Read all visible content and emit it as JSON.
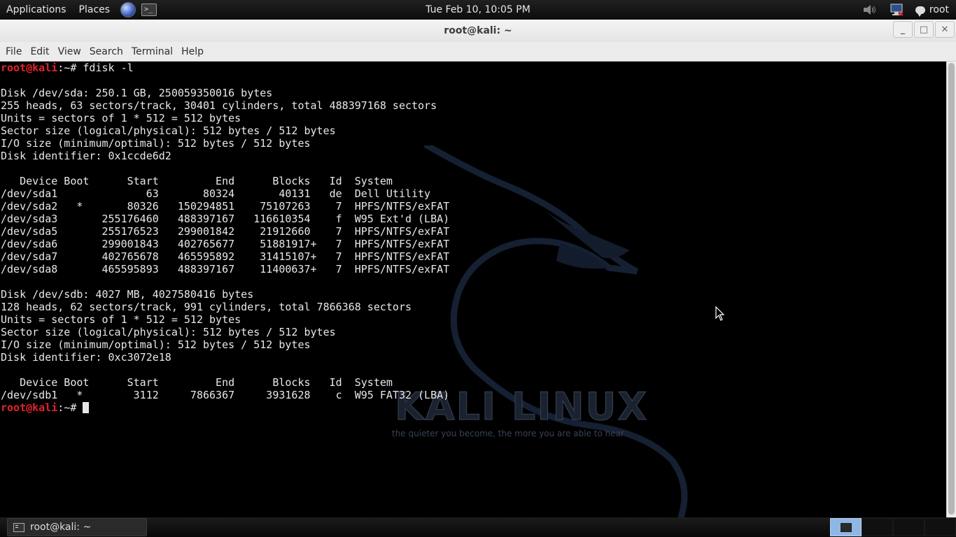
{
  "top_panel": {
    "applications": "Applications",
    "places": "Places",
    "clock": "Tue Feb 10, 10:05 PM",
    "user": "root"
  },
  "window": {
    "title": "root@kali: ~",
    "menu": [
      "File",
      "Edit",
      "View",
      "Search",
      "Terminal",
      "Help"
    ],
    "controls": {
      "minimize": "_",
      "maximize": "□",
      "close": "✕"
    }
  },
  "terminal": {
    "prompt_user": "root@kali",
    "prompt_path": ":~#",
    "command": " fdisk -l",
    "output": [
      "",
      "Disk /dev/sda: 250.1 GB, 250059350016 bytes",
      "255 heads, 63 sectors/track, 30401 cylinders, total 488397168 sectors",
      "Units = sectors of 1 * 512 = 512 bytes",
      "Sector size (logical/physical): 512 bytes / 512 bytes",
      "I/O size (minimum/optimal): 512 bytes / 512 bytes",
      "Disk identifier: 0x1ccde6d2",
      "",
      "   Device Boot      Start         End      Blocks   Id  System",
      "/dev/sda1              63       80324       40131   de  Dell Utility",
      "/dev/sda2   *       80326   150294851    75107263    7  HPFS/NTFS/exFAT",
      "/dev/sda3       255176460   488397167   116610354    f  W95 Ext'd (LBA)",
      "/dev/sda5       255176523   299001842    21912660    7  HPFS/NTFS/exFAT",
      "/dev/sda6       299001843   402765677    51881917+   7  HPFS/NTFS/exFAT",
      "/dev/sda7       402765678   465595892    31415107+   7  HPFS/NTFS/exFAT",
      "/dev/sda8       465595893   488397167    11400637+   7  HPFS/NTFS/exFAT",
      "",
      "Disk /dev/sdb: 4027 MB, 4027580416 bytes",
      "128 heads, 62 sectors/track, 991 cylinders, total 7866368 sectors",
      "Units = sectors of 1 * 512 = 512 bytes",
      "Sector size (logical/physical): 512 bytes / 512 bytes",
      "I/O size (minimum/optimal): 512 bytes / 512 bytes",
      "Disk identifier: 0xc3072e18",
      "",
      "   Device Boot      Start         End      Blocks   Id  System",
      "/dev/sdb1   *        3112     7866367     3931628    c  W95 FAT32 (LBA)"
    ]
  },
  "background": {
    "logo_text": "KALI LINUX",
    "tagline": "the quieter you become, the more you are able to hear"
  },
  "bottom_panel": {
    "task_label": "root@kali: ~",
    "workspaces": 4,
    "active_workspace": 1
  },
  "colors": {
    "prompt_user": "#e0242a",
    "prompt_path": "#7a8bd8",
    "terminal_bg": "#000000",
    "terminal_fg": "#e8e8e8"
  },
  "icons": [
    "globe-icon",
    "terminal-launcher-icon",
    "speaker-icon",
    "network-icon",
    "chat-icon",
    "terminal-task-icon",
    "mouse-pointer-icon"
  ]
}
